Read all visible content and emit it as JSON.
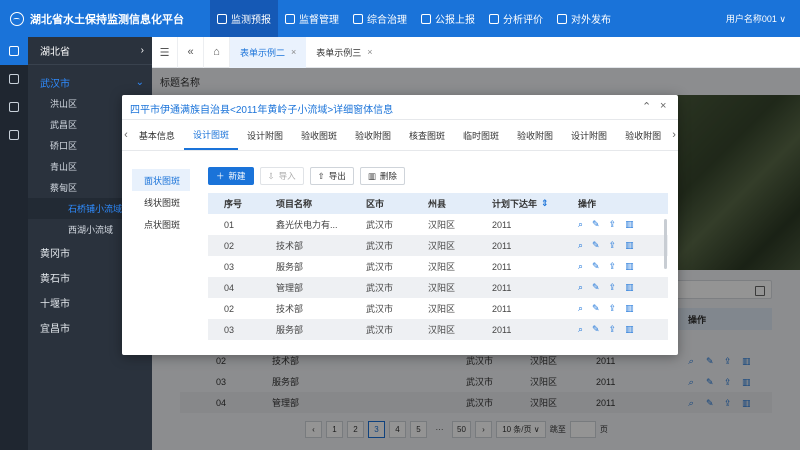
{
  "app": {
    "title": "湖北省水土保持监测信息化平台",
    "user": "用户名称001 ∨"
  },
  "nav": [
    {
      "label": "监测预报",
      "icon": "monitor-icon",
      "active": true
    },
    {
      "label": "监督管理",
      "icon": "supervise-icon"
    },
    {
      "label": "综合治理",
      "icon": "govern-icon"
    },
    {
      "label": "公报上报",
      "icon": "report-icon"
    },
    {
      "label": "分析评价",
      "icon": "analysis-icon"
    },
    {
      "label": "对外发布",
      "icon": "share-icon"
    }
  ],
  "sidebar": {
    "province": "湖北省",
    "city": "武汉市",
    "districts": [
      "洪山区",
      "武昌区",
      "硚口区",
      "青山区",
      "蔡甸区"
    ],
    "watersheds": [
      "石桥铺小流域",
      "西湖小流域"
    ],
    "cities": [
      "黄冈市",
      "黄石市",
      "十堰市",
      "宜昌市"
    ]
  },
  "page_tabs": [
    "表单示例二",
    "表单示例三"
  ],
  "page_title": "标题名称",
  "bg_table": {
    "header_ops": "操作",
    "rows": [
      {
        "seq": "02",
        "name": "技术部",
        "city": "武汉市",
        "county": "汉阳区",
        "year": "2011"
      },
      {
        "seq": "03",
        "name": "服务部",
        "city": "武汉市",
        "county": "汉阳区",
        "year": "2011"
      },
      {
        "seq": "04",
        "name": "管理部",
        "city": "武汉市",
        "county": "汉阳区",
        "year": "2011"
      }
    ]
  },
  "pager": {
    "pages": [
      "1",
      "2",
      "3",
      "4",
      "5",
      "···",
      "50"
    ],
    "current": "3",
    "size": "10 条/页 ∨",
    "jump": "跳至",
    "unit": "页"
  },
  "modal": {
    "title": "四平市伊通满族自治县<2011年黄岭子小流域>详细窗体信息",
    "tabs": [
      "基本信息",
      "设计图斑",
      "设计附图",
      "验收图斑",
      "验收附图",
      "核查图斑",
      "临时图斑",
      "验收附图",
      "设计附图",
      "验收附图"
    ],
    "active_tab": 1,
    "left_nav": [
      "面状图斑",
      "线状图斑",
      "点状图斑"
    ],
    "toolbar": {
      "new": "新建",
      "import": "导入",
      "export": "导出",
      "delete": "删除"
    },
    "columns": [
      "序号",
      "项目名称",
      "区市",
      "州县",
      "计划下达年",
      "操作"
    ],
    "rows": [
      {
        "seq": "01",
        "name": "鑫光伏电力有...",
        "city": "武汉市",
        "county": "汉阳区",
        "year": "2011"
      },
      {
        "seq": "02",
        "name": "技术部",
        "city": "武汉市",
        "county": "汉阳区",
        "year": "2011"
      },
      {
        "seq": "03",
        "name": "服务部",
        "city": "武汉市",
        "county": "汉阳区",
        "year": "2011"
      },
      {
        "seq": "04",
        "name": "管理部",
        "city": "武汉市",
        "county": "汉阳区",
        "year": "2011"
      },
      {
        "seq": "02",
        "name": "技术部",
        "city": "武汉市",
        "county": "汉阳区",
        "year": "2011"
      },
      {
        "seq": "03",
        "name": "服务部",
        "city": "武汉市",
        "county": "汉阳区",
        "year": "2011"
      }
    ]
  },
  "colors": {
    "primary": "#1a73d9",
    "sidebar": "#2a323d",
    "rail": "#1f2630"
  }
}
